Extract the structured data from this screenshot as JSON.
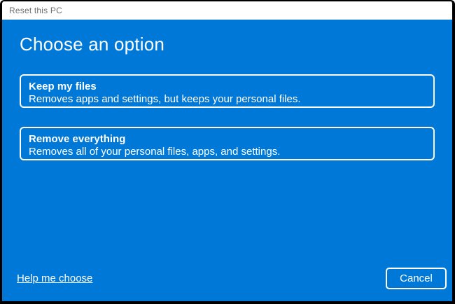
{
  "window": {
    "title": "Reset this PC"
  },
  "colors": {
    "accent_blue": "#0078d7",
    "titlebar_bg": "#ffffff",
    "titlebar_text": "#6e6e6e",
    "window_border": "#000000",
    "foreground": "#ffffff"
  },
  "header": {
    "title": "Choose an option"
  },
  "options": [
    {
      "title": "Keep my files",
      "description": "Removes apps and settings, but keeps your personal files."
    },
    {
      "title": "Remove everything",
      "description": "Removes all of your personal files, apps, and settings."
    }
  ],
  "footer": {
    "help_link_label": "Help me choose",
    "cancel_label": "Cancel"
  }
}
